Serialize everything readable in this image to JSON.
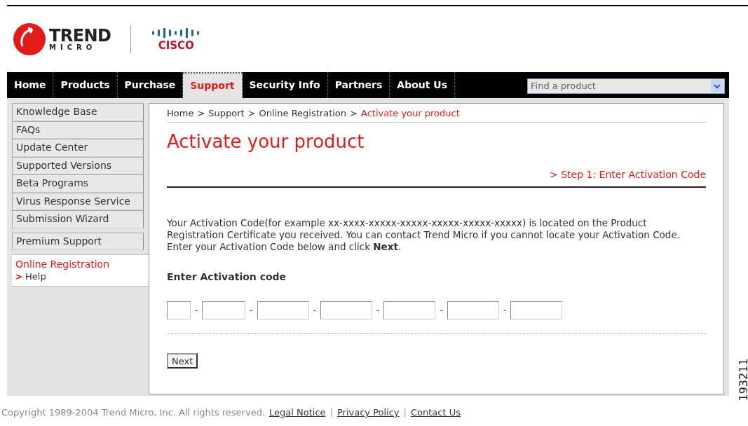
{
  "logos": {
    "trend_word": "TREND",
    "trend_sub": "MICRO",
    "cisco_word": "CISCO"
  },
  "nav": {
    "tabs": [
      {
        "label": "Home",
        "selected": false
      },
      {
        "label": "Products",
        "selected": false
      },
      {
        "label": "Purchase",
        "selected": false
      },
      {
        "label": "Support",
        "selected": true
      },
      {
        "label": "Security Info",
        "selected": false
      },
      {
        "label": "Partners",
        "selected": false
      },
      {
        "label": "About Us",
        "selected": false
      }
    ],
    "search": {
      "placeholder": "Find a product"
    }
  },
  "sidebar": {
    "groups": [
      [
        "Knowledge Base",
        "FAQs",
        "Update Center",
        "Supported Versions",
        "Beta Programs",
        "Virus Response Service",
        "Submission Wizard"
      ],
      [
        "Premium Support"
      ]
    ],
    "current": {
      "label": "Online Registration",
      "sub": "Help",
      "sub_marker": ">"
    }
  },
  "breadcrumb": [
    {
      "label": "Home",
      "current": false
    },
    {
      "label": "Support",
      "current": false
    },
    {
      "label": "Online Registration",
      "current": false
    },
    {
      "label": "Activate your product",
      "current": true
    }
  ],
  "breadcrumb_separator": ">",
  "title": "Activate your product",
  "step": "> Step 1: Enter Activation Code",
  "intro": "Your Activation Code(for example xx-xxxx-xxxxx-xxxxx-xxxxx-xxxxx-xxxxx) is located on the Product Registration Certificate you received. You can contact Trend Micro if you cannot locate your Activation Code. Enter your Activation Code below and click **Next**.",
  "code_label": "Enter Activation code",
  "code_fields": [
    {
      "kind": "short"
    },
    {
      "kind": "medium"
    },
    {
      "kind": "long"
    },
    {
      "kind": "long"
    },
    {
      "kind": "long"
    },
    {
      "kind": "long"
    },
    {
      "kind": "long"
    }
  ],
  "code_separator": "-",
  "next_button": "Next",
  "footer": {
    "copyright": "Copyright 1989-2004 Trend Micro, Inc. All rights reserved.",
    "links": [
      "Legal Notice",
      "Privacy Policy",
      "Contact Us"
    ],
    "separator": "|"
  },
  "figure_number": "193211"
}
